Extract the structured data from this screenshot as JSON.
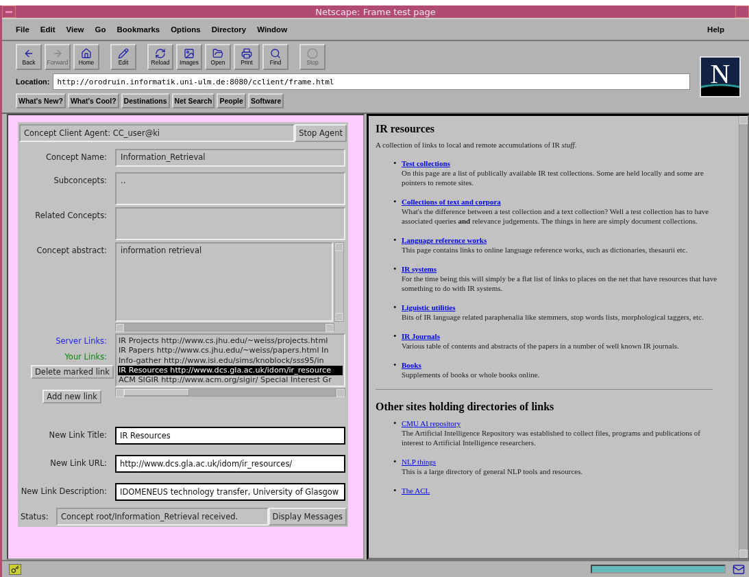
{
  "window": {
    "title": "Netscape: Frame test page"
  },
  "menu": [
    {
      "label": "File"
    },
    {
      "label": "Edit"
    },
    {
      "label": "View"
    },
    {
      "label": "Go"
    },
    {
      "label": "Bookmarks"
    },
    {
      "label": "Options"
    },
    {
      "label": "Directory"
    },
    {
      "label": "Window"
    }
  ],
  "help_menu": "Help",
  "toolbar": [
    {
      "label": "Back",
      "disabled": false
    },
    {
      "label": "Forward",
      "disabled": true
    },
    {
      "label": "Home",
      "disabled": false
    },
    {
      "label": "Edit",
      "disabled": false
    },
    {
      "label": "Reload",
      "disabled": false
    },
    {
      "label": "Images",
      "disabled": false
    },
    {
      "label": "Open",
      "disabled": false
    },
    {
      "label": "Print",
      "disabled": false
    },
    {
      "label": "Find",
      "disabled": false
    },
    {
      "label": "Stop",
      "disabled": true
    }
  ],
  "logo_letter": "N",
  "location": {
    "label": "Location:",
    "value": "http://orodruin.informatik.uni-ulm.de:8080/cclient/frame.html"
  },
  "directory_buttons": [
    "What's New?",
    "What's Cool?",
    "Destinations",
    "Net Search",
    "People",
    "Software"
  ],
  "agent_panel": {
    "agent": "Concept Client Agent: CC_user@ki",
    "stop_button": "Stop Agent",
    "concept_name": {
      "label": "Concept Name:",
      "value": "Information_Retrieval"
    },
    "subconcepts": {
      "label": "Subconcepts:",
      "value": ".."
    },
    "related": {
      "label": "Related Concepts:"
    },
    "abstract": {
      "label": "Concept abstract:",
      "value": "information retrieval"
    },
    "server_links_label": "Server Links:",
    "your_links_label": "Your Links:",
    "delete_button": "Delete marked link",
    "add_button": "Add new link",
    "links": [
      {
        "text": "IR Projects http://www.cs.jhu.edu/~weiss/projects.html",
        "selected": false
      },
      {
        "text": "IR Papers http://www.cs.jhu.edu/~weiss/papers.html In",
        "selected": false
      },
      {
        "text": "Info-gather http://www.isi.edu/sims/knoblock/sss95/in",
        "selected": false
      },
      {
        "text": "IR Resources http://www.dcs.gla.ac.uk/idom/ir_resource",
        "selected": true
      },
      {
        "text": "ACM SIGIR http://www.acm.org/sigir/ Special Interest Gr",
        "selected": false
      }
    ],
    "new_title": {
      "label": "New Link Title:",
      "value": "IR Resources"
    },
    "new_url": {
      "label": "New Link URL:",
      "value": "http://www.dcs.gla.ac.uk/idom/ir_resources/"
    },
    "new_description": {
      "label": "New Link Description:",
      "value": "IDOMENEUS technology transfer, University of Glasgow"
    },
    "status": {
      "label": "Status:",
      "value": "Concept root/Information_Retrieval received."
    },
    "messages_button": "Display Messages"
  },
  "document": {
    "sections": [
      {
        "heading": "IR resources",
        "intro": "A collection of links to local and remote accumulations of IR *stuff*.",
        "bold_links": true,
        "items": [
          {
            "bullet": "•",
            "link": "Test collections",
            "description": "On this page are a list of publically available IR test collections. Some are held locally and some are pointers to remote sites."
          },
          {
            "bullet": "•",
            "link": "Collections of text and corpora",
            "description": "What's the difference between a test collection and a text collection? Well a test collection has to have associated queries **and** relevance judgements. The things in here are simply document collections."
          },
          {
            "bullet": "•",
            "link": "Language reference works",
            "description": "This page contains links to online language reference works, such as dictionaries, thesaurii etc."
          },
          {
            "bullet": "•",
            "link": "IR systems",
            "description": "For the time being this will simply be a flat list of links to places on the net that have resources that have something to do with IR systems."
          },
          {
            "bullet": "•",
            "link": "Liguistic utilities",
            "description": "Bits of IR language related paraphenalia like stemmers, stop words lists, morphological taggers, etc."
          },
          {
            "bullet": "•",
            "link": "IR Journals",
            "description": "Various table of contents and abstracts of the papers in a number of well known IR journals."
          },
          {
            "bullet": "•",
            "link": "Books",
            "description": "Supplements of books or whole books online."
          }
        ]
      },
      {
        "heading": "Other sites holding directories of links",
        "bold_links": false,
        "items": [
          {
            "bullet": "•",
            "link": "CMU AI repository",
            "description": "The Artificial Intelligence Repository was established to collect files, programs and publications of interest to Artificial Intelligence researchers."
          },
          {
            "bullet": "•",
            "link": "NLP things",
            "description": "This is a large directory of general NLP tools and resources."
          },
          {
            "bullet": "•",
            "link": "The ACL"
          }
        ]
      }
    ]
  },
  "status_bar": {
    "progress": {
      "level": 1
    }
  }
}
